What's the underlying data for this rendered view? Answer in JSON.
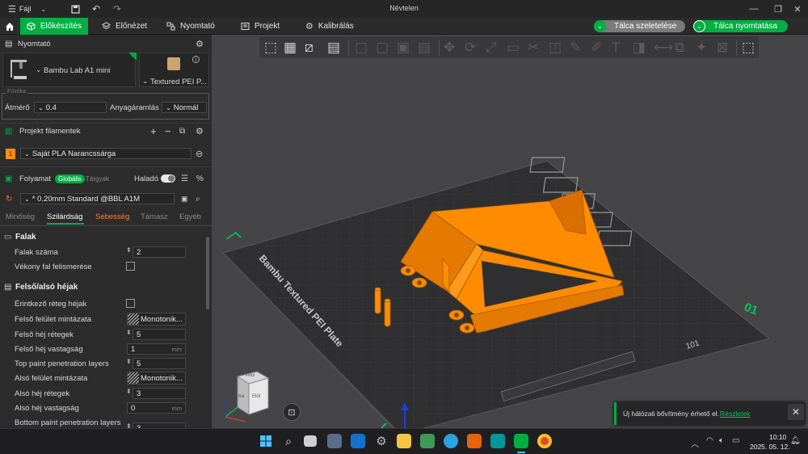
{
  "window": {
    "title": "Névtelen",
    "file_menu": "Fájl"
  },
  "tabs": {
    "prepare": "Előkészítés",
    "preview": "Előnézet",
    "device": "Nyomtató",
    "project": "Projekt",
    "calibration": "Kalibrálás"
  },
  "actions": {
    "slice": "Tálca szeletelése",
    "print": "Tálca nyomtatása"
  },
  "printer": {
    "section": "Nyomtató",
    "name": "Bambu Lab A1 mini",
    "plate": "Textured PEI P...",
    "nozzle_group": "Fúvóka",
    "diameter_label": "Átmérő",
    "diameter": "0.4",
    "flow_label": "Anyagáramlás",
    "flow": "Normál"
  },
  "filament": {
    "section": "Projekt filamentek",
    "slot": "1",
    "name": "Saját PLA Narancssárga",
    "slot_color": "#ff8c1a"
  },
  "process": {
    "section": "Folyamat",
    "global": "Globális",
    "objects": "Tárgyak",
    "advanced": "Haladó",
    "preset": "* 0.20mm Standard @BBL A1M",
    "subtabs": [
      "Minőség",
      "Szilárdság",
      "Sebesség",
      "Támasz",
      "Egyéb"
    ]
  },
  "settings": {
    "walls_header": "Falak",
    "wall_loops_label": "Falak száma",
    "wall_loops": "2",
    "thin_wall_label": "Vékony fal felismerése",
    "shells_header": "Felső/alsó héjak",
    "interface_shells_label": "Érintkező réteg héjak",
    "top_pattern_label": "Felső felület mintázata",
    "top_pattern": "Monotonik...",
    "top_layers_label": "Felső héj rétegek",
    "top_layers": "5",
    "top_thickness_label": "Felső héj vastagság",
    "top_thickness": "1",
    "top_paint_label": "Top paint penetration layers",
    "top_paint": "5",
    "bottom_pattern_label": "Alsó felület mintázata",
    "bottom_pattern": "Monotonik...",
    "bottom_layers_label": "Alsó héj rétegek",
    "bottom_layers": "3",
    "bottom_thickness_label": "Alsó héj vastagság",
    "bottom_thickness": "0",
    "bottom_paint_label": "Bottom paint penetration layers",
    "bottom_paint": "3",
    "unit_mm": "mm"
  },
  "viewport": {
    "plate_label": "Bambu Textured PEI Plate",
    "plate_number": "01",
    "cube_front": "Elöl",
    "cube_top": "Felül",
    "cube_left": "Bal",
    "bed_color": "#2f2f31",
    "part_color": "#ff8c00"
  },
  "notification": {
    "text": "Új hálózati bővítmény érhető el.",
    "link": "Részletek"
  },
  "taskbar": {
    "time": "10:10",
    "date": "2025. 05. 12."
  }
}
